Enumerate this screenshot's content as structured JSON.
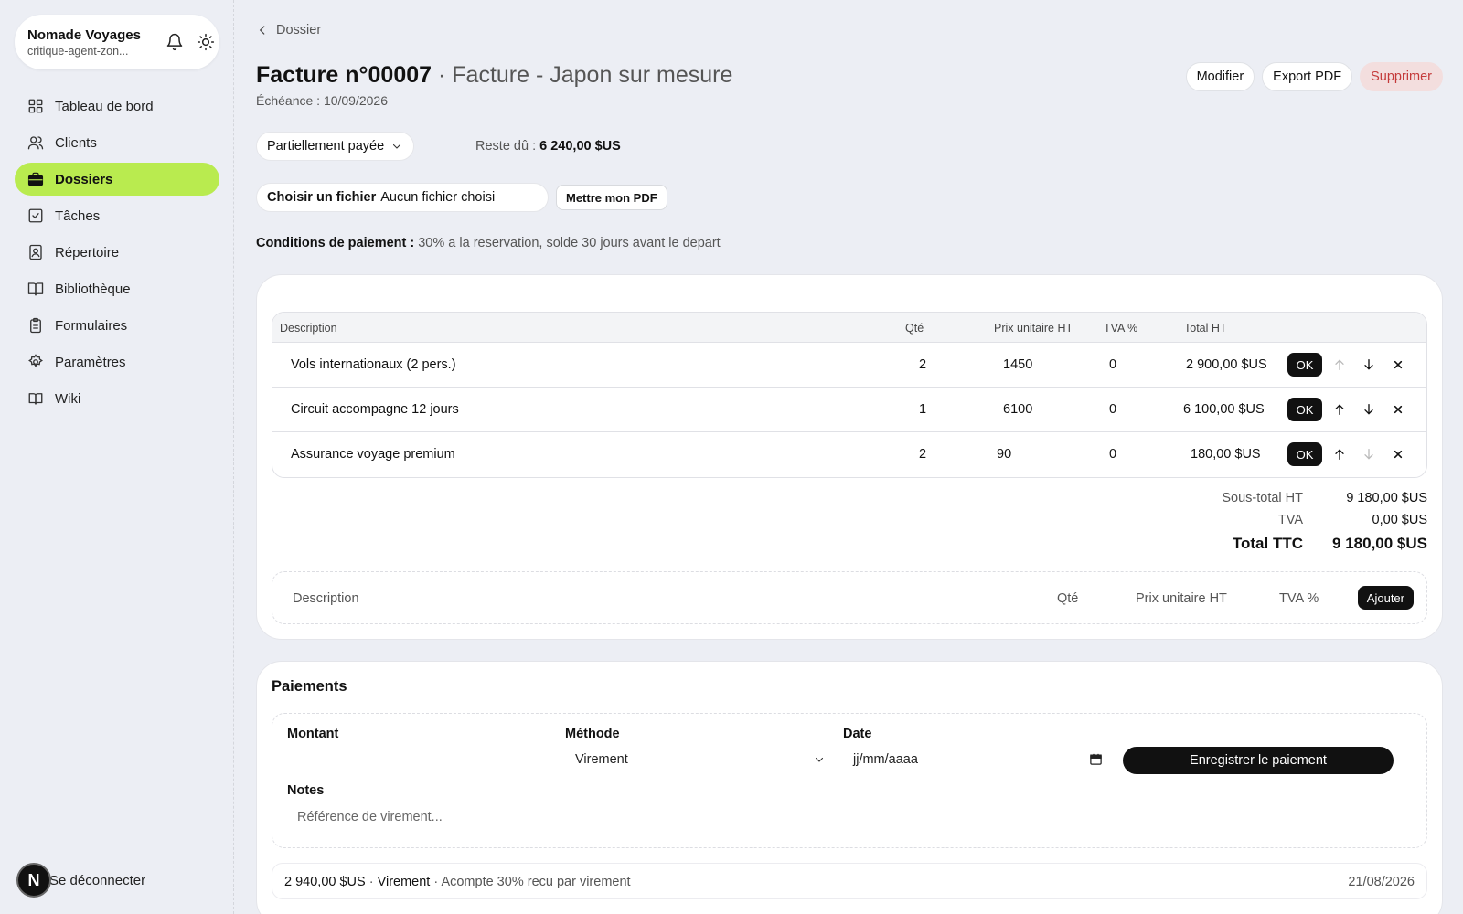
{
  "org": {
    "name": "Nomade Voyages",
    "subtitle": "critique-agent-zon..."
  },
  "nav": [
    {
      "label": "Tableau de bord",
      "icon": "grid-icon"
    },
    {
      "label": "Clients",
      "icon": "users-icon"
    },
    {
      "label": "Dossiers",
      "icon": "briefcase-icon",
      "active": true
    },
    {
      "label": "Tâches",
      "icon": "checkbox-icon"
    },
    {
      "label": "Répertoire",
      "icon": "contact-book-icon"
    },
    {
      "label": "Bibliothèque",
      "icon": "book-icon"
    },
    {
      "label": "Formulaires",
      "icon": "clipboard-icon"
    },
    {
      "label": "Paramètres",
      "icon": "gear-icon"
    },
    {
      "label": "Wiki",
      "icon": "open-book-icon"
    }
  ],
  "logout": {
    "avatar": "N",
    "label": "Se déconnecter"
  },
  "breadcrumb": "Dossier",
  "header": {
    "number": "Facture n°00007",
    "separator": "·",
    "subtitle": "Facture - Japon sur mesure",
    "due": "Échéance : 10/09/2026",
    "actions": {
      "edit": "Modifier",
      "export": "Export PDF",
      "delete": "Supprimer"
    }
  },
  "status": {
    "value": "Partiellement payée"
  },
  "balance": {
    "label": "Reste dû :",
    "value": "6 240,00 $US"
  },
  "file": {
    "choose": "Choisir un fichier",
    "none": "Aucun fichier choisi",
    "upload": "Mettre mon PDF"
  },
  "conditions": {
    "label": "Conditions de paiement :",
    "value": "30% a la reservation, solde 30 jours avant le depart"
  },
  "table": {
    "headers": {
      "description": "Description",
      "qty": "Qté",
      "unit": "Prix unitaire HT",
      "vat": "TVA %",
      "total": "Total HT"
    },
    "ok_label": "OK",
    "rows": [
      {
        "description": "Vols internationaux (2 pers.)",
        "qty": "2",
        "unit": "1450",
        "vat": "0",
        "total": "2 900,00 $US"
      },
      {
        "description": "Circuit accompagne 12 jours",
        "qty": "1",
        "unit": "6100",
        "vat": "0",
        "total": "6 100,00 $US"
      },
      {
        "description": "Assurance voyage premium",
        "qty": "2",
        "unit": "90",
        "vat": "0",
        "total": "180,00 $US"
      }
    ]
  },
  "totals": {
    "subtotal_label": "Sous-total HT",
    "subtotal": "9 180,00 $US",
    "vat_label": "TVA",
    "vat": "0,00 $US",
    "total_label": "Total TTC",
    "total": "9 180,00 $US"
  },
  "new_line": {
    "description": "Description",
    "qty": "Qté",
    "unit": "Prix unitaire HT",
    "vat": "TVA %",
    "add": "Ajouter"
  },
  "payments": {
    "title": "Paiements",
    "amount_label": "Montant",
    "method_label": "Méthode",
    "method_value": "Virement",
    "date_label": "Date",
    "date_placeholder": "jj/mm/aaaa",
    "notes_label": "Notes",
    "notes_placeholder": "Référence de virement...",
    "save": "Enregistrer le paiement",
    "entries": [
      {
        "amount": "2 940,00 $US",
        "method": "Virement",
        "note": "Acompte 30% recu par virement",
        "date": "21/08/2026"
      }
    ]
  }
}
